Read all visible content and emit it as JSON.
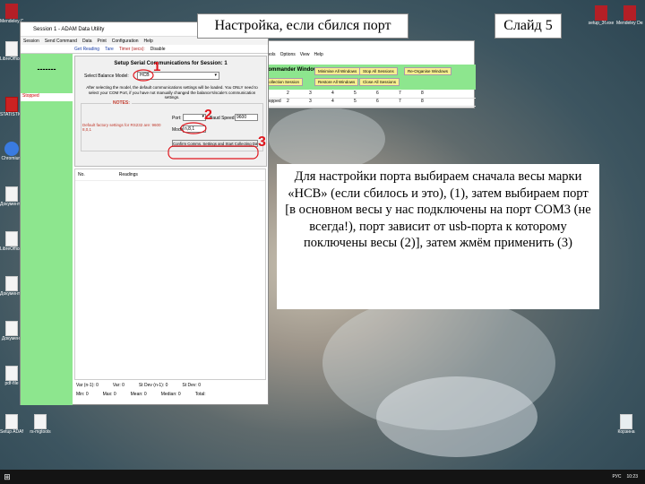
{
  "slide": {
    "title": "Настройка, если сбился порт",
    "number": "Слайд 5",
    "note": "Для настройки порта выбираем сначала весы марки «НСВ» (если сбилось и это), (1), затем выбираем порт [в основном весы у нас подключены на порт СОМ3 (не всегда!), порт зависит от usb-порта к которому поключены весы (2)], затем жмём применить (3)"
  },
  "desktop": {
    "left_icons": [
      "Mendeley Desktop",
      "LibreOffice 6.0",
      "STATISTICA",
      "Chromium",
      "Документ Microsoft Word",
      "LibreOffice Calc",
      "Документ OpenDocument",
      "Документ",
      "pdf-file",
      "Безымянный",
      "Setup ADAM",
      "rs-mgtools"
    ],
    "right_icons": [
      "setup_3f.exe",
      "Mendeley Desktop"
    ],
    "recycle_bin": "Корзина"
  },
  "adam_window": {
    "title": "Session 1 - ADAM Data Utility",
    "menu": [
      "Session",
      "Send Command",
      "Data",
      "Print",
      "Configuration",
      "Help"
    ],
    "toolbar": [
      "Get Reading",
      "Tare",
      "Timer (secs):",
      "Disable"
    ],
    "panel_dash": "-------",
    "status": "Stopped",
    "dialog": {
      "heading": "Setup Serial Communications for Session: 1",
      "balance_label": "Select Balance Model:",
      "balance_value": "HCB",
      "description": "After selecting the model, the default communications settings will be loaded. You ONLY need to select your COM Port, if you have not manually changed the balance's/scale's communication settings.",
      "notes_label": "NOTES:",
      "defaults_text": "Default factory settings for RS232 are: 9600 8,0,1",
      "port_label": "Port:",
      "baud_label": "Baud Speed:",
      "baud_value": "9600",
      "mode_label": "Mode:",
      "mode_value": "n,8,1",
      "confirm_button": "Confirm Comms. Settings and Start Collecting Data"
    },
    "readings_header": [
      "No.",
      "Readings"
    ],
    "stats_row1": [
      "Var (n-1): 0",
      "Var: 0",
      "St Dev (n-1): 0",
      "St Dev: 0"
    ],
    "stats_row2": [
      "Min: 0",
      "Max: 0",
      "Mean: 0",
      "Median: 0",
      "Total: "
    ]
  },
  "commander_window": {
    "menu": [
      "tools",
      "Options",
      "View",
      "Help"
    ],
    "title": "Commander Window",
    "buttons": [
      "Minimise All Windows",
      "Stop All Sessions",
      "Re-Organise Windows",
      "Collection Session",
      "Restore All Windows",
      "Close All Sessions"
    ],
    "grid_header": [
      "1",
      "2",
      "3",
      "4",
      "5",
      "6",
      "7",
      "8"
    ],
    "grid_row": [
      "Stopped",
      "2",
      "3",
      "4",
      "5",
      "6",
      "7",
      "8"
    ]
  },
  "annotations": [
    "1",
    "2",
    "3"
  ],
  "taskbar": {
    "lang": "РУС",
    "time": "10:23"
  },
  "colors": {
    "green_panel": "#8de68e",
    "annotation": "#e0161d"
  }
}
